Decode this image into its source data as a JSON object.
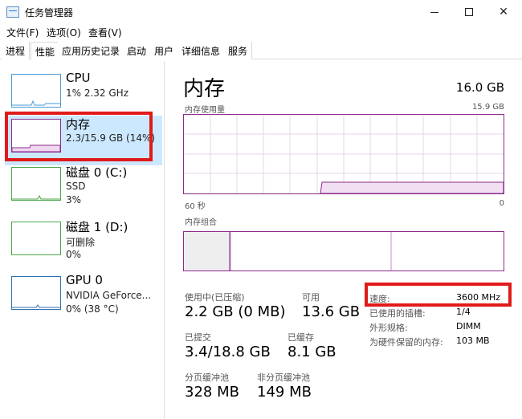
{
  "window": {
    "title": "任务管理器"
  },
  "menu": [
    "文件(F)",
    "选项(O)",
    "查看(V)"
  ],
  "tabs": [
    "进程",
    "性能",
    "应用历史记录",
    "启动",
    "用户",
    "详细信息",
    "服务"
  ],
  "sidebar": {
    "items": [
      {
        "title": "CPU",
        "line1": "1% 2.32 GHz",
        "line2": ""
      },
      {
        "title": "内存",
        "line1": "2.3/15.9 GB (14%)",
        "line2": ""
      },
      {
        "title": "磁盘 0 (C:)",
        "line1": "SSD",
        "line2": "3%"
      },
      {
        "title": "磁盘 1 (D:)",
        "line1": "可删除",
        "line2": "0%"
      },
      {
        "title": "GPU 0",
        "line1": "NVIDIA GeForce...",
        "line2": "0% (38 °C)"
      }
    ]
  },
  "memory": {
    "title": "内存",
    "total": "16.0 GB",
    "usage_label": "内存使用量",
    "usage_max": "15.9 GB",
    "axis_left": "60 秒",
    "axis_right": "0",
    "composition_label": "内存组合",
    "stats": {
      "in_use_label": "使用中(已压缩)",
      "in_use_value": "2.2 GB (0 MB)",
      "available_label": "可用",
      "available_value": "13.6 GB",
      "committed_label": "已提交",
      "committed_value": "3.4/18.8 GB",
      "cached_label": "已缓存",
      "cached_value": "8.1 GB",
      "paged_label": "分页缓冲池",
      "paged_value": "328 MB",
      "nonpaged_label": "非分页缓冲池",
      "nonpaged_value": "149 MB"
    },
    "details": {
      "speed_label": "速度:",
      "speed_value": "3600 MHz",
      "slots_label": "已使用的插槽:",
      "slots_value": "1/4",
      "form_label": "外形规格:",
      "form_value": "DIMM",
      "reserved_label": "为硬件保留的内存:",
      "reserved_value": "103 MB"
    }
  },
  "colors": {
    "memory_accent": "#8b2a8b",
    "highlight": "#e01a1a",
    "selected_bg": "#cce8ff"
  }
}
